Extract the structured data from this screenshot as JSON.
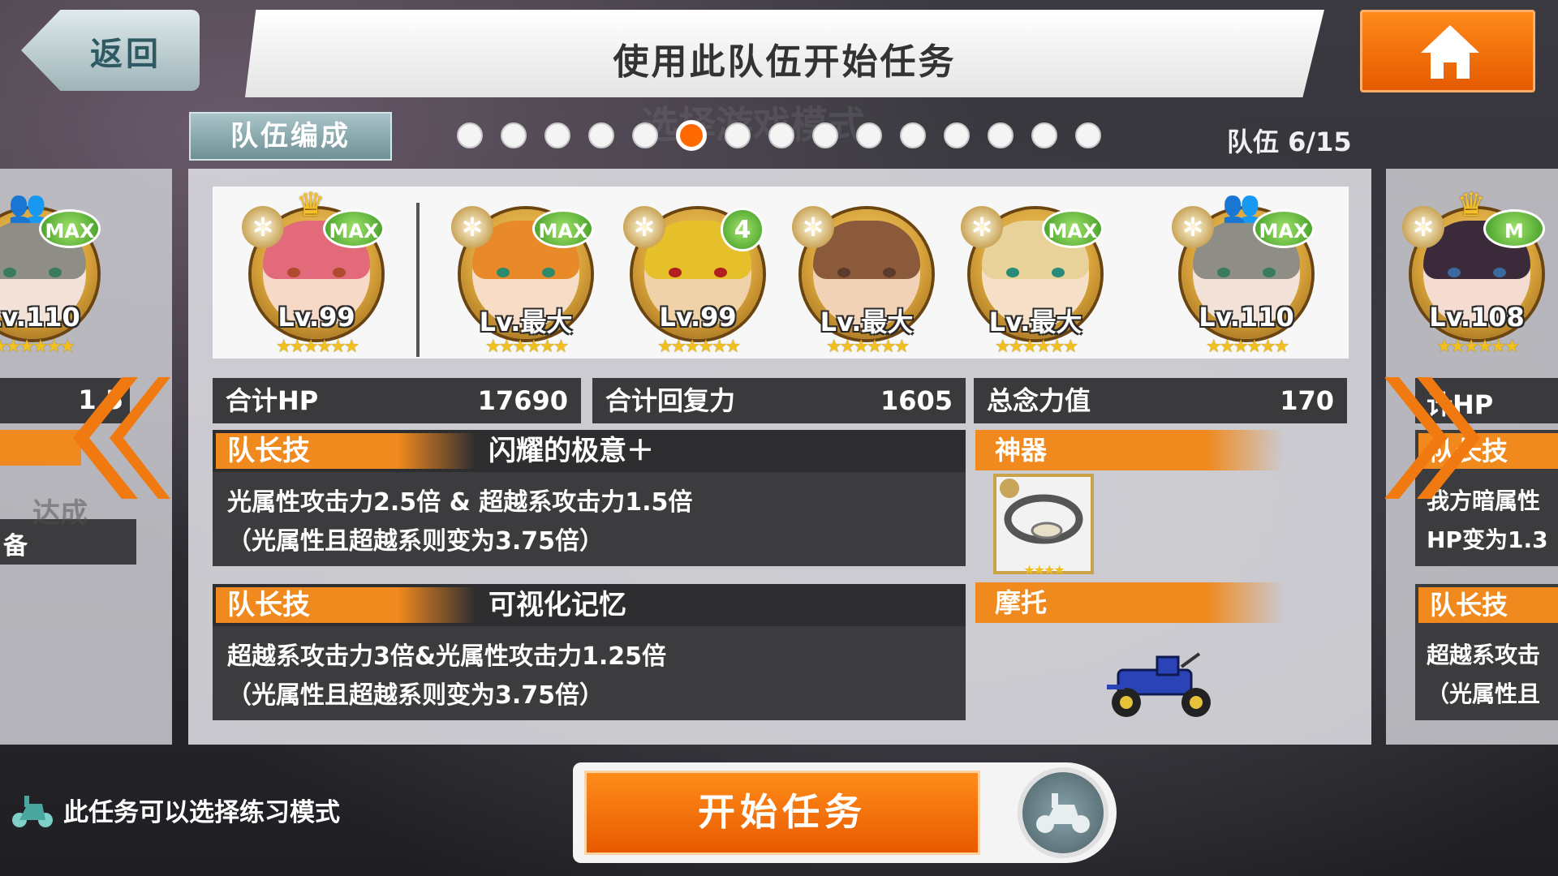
{
  "header": {
    "back_label": "返回",
    "title": "使用此队伍开始任务",
    "home_icon": "home-icon"
  },
  "team_nav": {
    "form_button": "队伍编成",
    "counter": "队伍 6/15",
    "total_pages": 15,
    "active_page": 6
  },
  "characters": [
    {
      "level": "Lv.110",
      "stars": "★★★★★★",
      "badge": "MAX",
      "marker": "friend",
      "theme": "silver"
    },
    {
      "level": "Lv.99",
      "stars": "★★★★★★",
      "badge": "MAX",
      "marker": "crown",
      "theme": "pink"
    },
    {
      "level": "Lv.最大",
      "stars": "★★★★★★",
      "badge": "MAX",
      "marker": "",
      "theme": "ginger"
    },
    {
      "level": "Lv.99",
      "stars": "★★★★★★",
      "badge": "4",
      "marker": "",
      "theme": "blond"
    },
    {
      "level": "Lv.最大",
      "stars": "★★★★★★",
      "badge": "",
      "marker": "",
      "theme": "brown"
    },
    {
      "level": "Lv.最大",
      "stars": "★★★★★★",
      "badge": "MAX",
      "marker": "",
      "theme": "cream"
    },
    {
      "level": "Lv.110",
      "stars": "★★★★★★",
      "badge": "MAX",
      "marker": "friend",
      "theme": "silver"
    },
    {
      "level": "Lv.108",
      "stars": "★★★★★★",
      "badge": "M",
      "marker": "crown",
      "theme": "dark"
    }
  ],
  "stats": {
    "hp_label": "合计HP",
    "hp_value": "17690",
    "recovery_label": "合计回复力",
    "recovery_value": "1605",
    "willpower_label": "总念力值",
    "willpower_value": "170"
  },
  "leader_skills": [
    {
      "tag": "队长技",
      "name": "闪耀的极意＋",
      "line1": "光属性攻击力2.5倍 & 超越系攻击力1.5倍",
      "line2": "（光属性且超越系则变为3.75倍）"
    },
    {
      "tag": "队长技",
      "name": "可视化记忆",
      "line1": "超越系攻击力3倍&光属性攻击力1.25倍",
      "line2": "（光属性且超越系则变为3.75倍）"
    }
  ],
  "equipment": {
    "artifact_label": "神器",
    "artifact_stars": "★★★★",
    "artifact_icon": "bracelet-icon",
    "motor_label": "摩托",
    "motor_icon": "vintage-car-icon"
  },
  "left_peek": {
    "value": "1  5",
    "text1": "达成",
    "text2": "备"
  },
  "right_peek": {
    "hp_label": "计HP",
    "skill_tag": "队长技",
    "skill_line1": "我方暗属性",
    "skill_line2": "HP变为1.3",
    "skill_tag2": "队长技",
    "skill_line3": "超越系攻击",
    "skill_line4": "（光属性且"
  },
  "footer": {
    "practice_text": "此任务可以选择练习模式",
    "start_button": "开始任务",
    "practice_icon": "scooter-icon"
  },
  "colors": {
    "accent": "#f08a1e",
    "dark_bar": "#3a3a3d",
    "nav_teal": "#7f9fa4"
  }
}
